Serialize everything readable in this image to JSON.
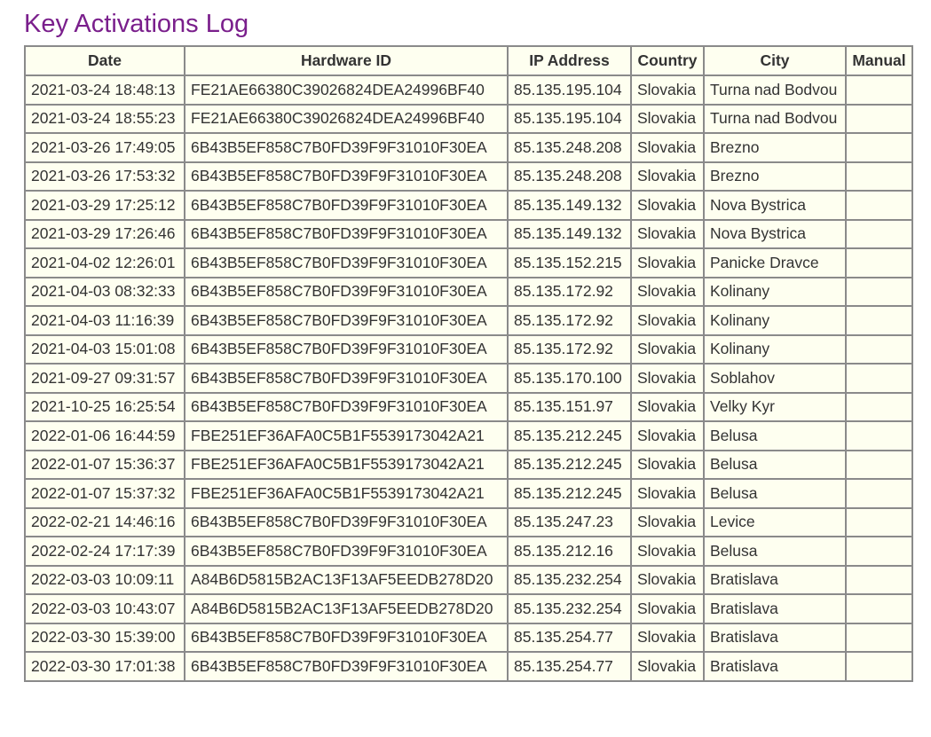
{
  "page": {
    "title": "Key Activations Log"
  },
  "table": {
    "columns": [
      "Date",
      "Hardware ID",
      "IP Address",
      "Country",
      "City",
      "Manual"
    ],
    "rows": [
      [
        "2021-03-24 18:48:13",
        "FE21AE66380C39026824DEA24996BF40",
        "85.135.195.104",
        "Slovakia",
        "Turna nad Bodvou",
        ""
      ],
      [
        "2021-03-24 18:55:23",
        "FE21AE66380C39026824DEA24996BF40",
        "85.135.195.104",
        "Slovakia",
        "Turna nad Bodvou",
        ""
      ],
      [
        "2021-03-26 17:49:05",
        "6B43B5EF858C7B0FD39F9F31010F30EA",
        "85.135.248.208",
        "Slovakia",
        "Brezno",
        ""
      ],
      [
        "2021-03-26 17:53:32",
        "6B43B5EF858C7B0FD39F9F31010F30EA",
        "85.135.248.208",
        "Slovakia",
        "Brezno",
        ""
      ],
      [
        "2021-03-29 17:25:12",
        "6B43B5EF858C7B0FD39F9F31010F30EA",
        "85.135.149.132",
        "Slovakia",
        "Nova Bystrica",
        ""
      ],
      [
        "2021-03-29 17:26:46",
        "6B43B5EF858C7B0FD39F9F31010F30EA",
        "85.135.149.132",
        "Slovakia",
        "Nova Bystrica",
        ""
      ],
      [
        "2021-04-02 12:26:01",
        "6B43B5EF858C7B0FD39F9F31010F30EA",
        "85.135.152.215",
        "Slovakia",
        "Panicke Dravce",
        ""
      ],
      [
        "2021-04-03 08:32:33",
        "6B43B5EF858C7B0FD39F9F31010F30EA",
        "85.135.172.92",
        "Slovakia",
        "Kolinany",
        ""
      ],
      [
        "2021-04-03 11:16:39",
        "6B43B5EF858C7B0FD39F9F31010F30EA",
        "85.135.172.92",
        "Slovakia",
        "Kolinany",
        ""
      ],
      [
        "2021-04-03 15:01:08",
        "6B43B5EF858C7B0FD39F9F31010F30EA",
        "85.135.172.92",
        "Slovakia",
        "Kolinany",
        ""
      ],
      [
        "2021-09-27 09:31:57",
        "6B43B5EF858C7B0FD39F9F31010F30EA",
        "85.135.170.100",
        "Slovakia",
        "Soblahov",
        ""
      ],
      [
        "2021-10-25 16:25:54",
        "6B43B5EF858C7B0FD39F9F31010F30EA",
        "85.135.151.97",
        "Slovakia",
        "Velky Kyr",
        ""
      ],
      [
        "2022-01-06 16:44:59",
        "FBE251EF36AFA0C5B1F5539173042A21",
        "85.135.212.245",
        "Slovakia",
        "Belusa",
        ""
      ],
      [
        "2022-01-07 15:36:37",
        "FBE251EF36AFA0C5B1F5539173042A21",
        "85.135.212.245",
        "Slovakia",
        "Belusa",
        ""
      ],
      [
        "2022-01-07 15:37:32",
        "FBE251EF36AFA0C5B1F5539173042A21",
        "85.135.212.245",
        "Slovakia",
        "Belusa",
        ""
      ],
      [
        "2022-02-21 14:46:16",
        "6B43B5EF858C7B0FD39F9F31010F30EA",
        "85.135.247.23",
        "Slovakia",
        "Levice",
        ""
      ],
      [
        "2022-02-24 17:17:39",
        "6B43B5EF858C7B0FD39F9F31010F30EA",
        "85.135.212.16",
        "Slovakia",
        "Belusa",
        ""
      ],
      [
        "2022-03-03 10:09:11",
        "A84B6D5815B2AC13F13AF5EEDB278D20",
        "85.135.232.254",
        "Slovakia",
        "Bratislava",
        ""
      ],
      [
        "2022-03-03 10:43:07",
        "A84B6D5815B2AC13F13AF5EEDB278D20",
        "85.135.232.254",
        "Slovakia",
        "Bratislava",
        ""
      ],
      [
        "2022-03-30 15:39:00",
        "6B43B5EF858C7B0FD39F9F31010F30EA",
        "85.135.254.77",
        "Slovakia",
        "Bratislava",
        ""
      ],
      [
        "2022-03-30 17:01:38",
        "6B43B5EF858C7B0FD39F9F31010F30EA",
        "85.135.254.77",
        "Slovakia",
        "Bratislava",
        ""
      ]
    ]
  },
  "colors": {
    "title": "#7a1f8c",
    "table_background": "#fefff0",
    "border": "#8a8a8a",
    "text": "#333333"
  }
}
